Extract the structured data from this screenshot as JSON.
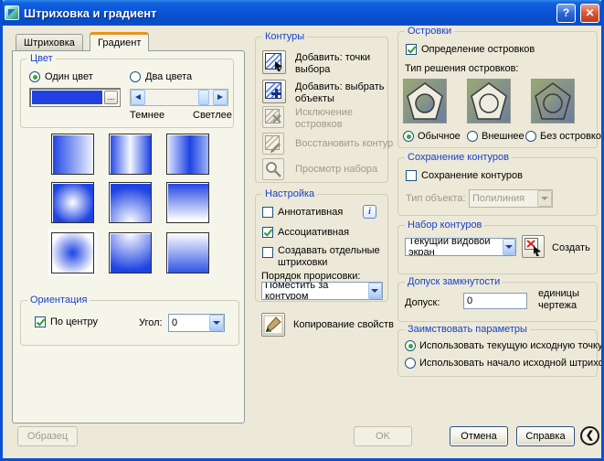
{
  "window": {
    "title": "Штриховка и градиент",
    "accent_blue": "#0b50d2",
    "gradient_blue": "#1d43e4"
  },
  "icons": {
    "help": "?",
    "close": "✕",
    "browse": "...",
    "shade_left": "◄",
    "shade_right": "►",
    "info": "i",
    "collapse": "❮"
  },
  "tabs": [
    {
      "label": "Штриховка"
    },
    {
      "label": "Градиент"
    }
  ],
  "color_group": {
    "title": "Цвет",
    "one_color": "Один цвет",
    "two_colors": "Два цвета",
    "darker": "Темнее",
    "lighter": "Светлее"
  },
  "gradient_swatches": {
    "selected_index": 6,
    "items": [
      "linear",
      "cylinder",
      "inverted-cylinder",
      "spherical",
      "hemispherical",
      "curved",
      "inverted-spherical",
      "inverted-hemispherical",
      "inverted-curved"
    ]
  },
  "orientation_group": {
    "title": "Ориентация",
    "centered": "По центру",
    "angle_label": "Угол:",
    "angle_value": "0"
  },
  "boundaries_group": {
    "title": "Контуры",
    "add_pick_points": "Добавить: точки выбора",
    "add_select_objects": "Добавить: выбрать объекты",
    "remove_islands": "Исключение островков",
    "recreate_boundary": "Восстановить контур",
    "view_selections": "Просмотр набора"
  },
  "options_group": {
    "title": "Настройка",
    "annotative": "Аннотативная",
    "associative": "Ассоциативная",
    "separate_hatches": "Создавать отдельные штриховки",
    "draw_order_label": "Порядок прорисовки:",
    "draw_order_value": "Поместить за контуром"
  },
  "inherit_properties": "Копирование свойств",
  "islands_group": {
    "title": "Островки",
    "island_detection": "Определение островков",
    "style_label": "Тип решения островков:",
    "style_normal": "Обычное",
    "style_outer": "Внешнее",
    "style_ignore": "Без островков"
  },
  "retention_group": {
    "title": "Сохранение контуров",
    "retain": "Сохранение контуров",
    "object_type_label": "Тип объекта:",
    "object_type_value": "Полилиния"
  },
  "boundary_set_group": {
    "title": "Набор контуров",
    "value": "Текущий видовой экран",
    "new_label": "Создать"
  },
  "gap_group": {
    "title": "Допуск замкнутости",
    "label": "Допуск:",
    "value": "0",
    "units_line1": "единицы",
    "units_line2": "чертежа"
  },
  "origin_group": {
    "title": "Заимствовать параметры",
    "use_current": "Использовать текущую исходную точку",
    "use_source": "Использовать начало исходной штриховки"
  },
  "footer": {
    "preview": "Образец",
    "ok": "OK",
    "cancel": "Отмена",
    "help": "Справка"
  }
}
